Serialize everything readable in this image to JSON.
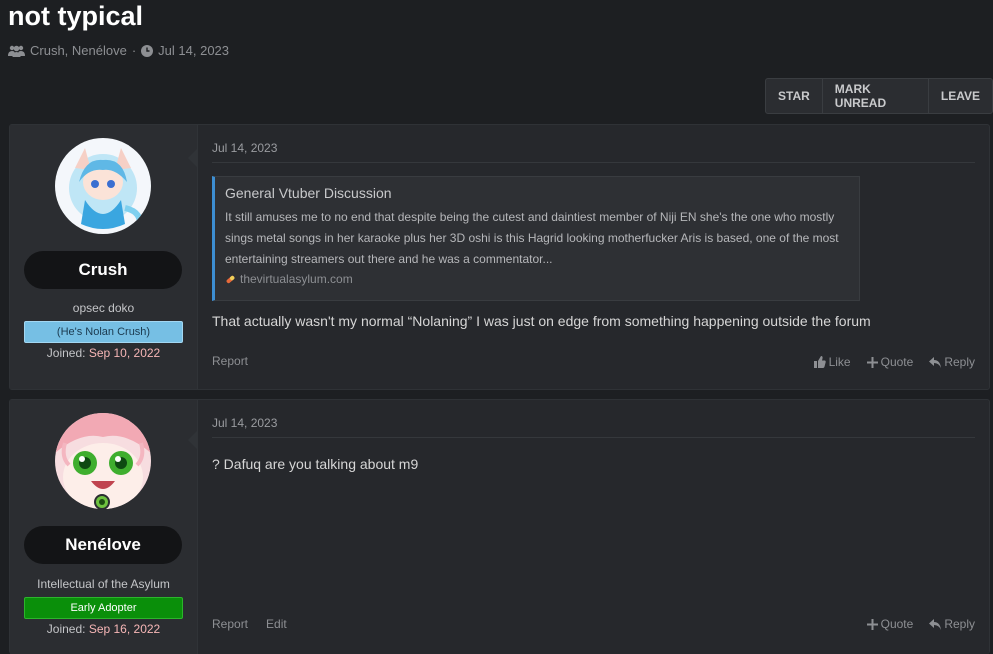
{
  "thread": {
    "title": "not typical",
    "participants": "Crush, Nenélove",
    "separator": "·",
    "date": "Jul 14, 2023"
  },
  "toolbar": {
    "star": "STAR",
    "mark_unread": "MARK UNREAD",
    "leave": "LEAVE"
  },
  "posts": [
    {
      "user": {
        "name": "Crush",
        "title": "opsec doko",
        "banner": "(He's Nolan Crush)",
        "joined_label": "Joined:",
        "joined_date": "Sep 10, 2022"
      },
      "date": "Jul 14, 2023",
      "quote": {
        "title": "General Vtuber Discussion",
        "body": "It still amuses me to no end that despite being the cutest and daintiest member of Niji EN she's the one who mostly sings metal songs in her karaoke plus her 3D oshi is this Hagrid looking motherfucker Aris is based, one of the most entertaining streamers out there and he was a commentator...",
        "source": "thevirtualasylum.com"
      },
      "text": "That actually wasn't my normal “Nolaning” I was just on edge from something happening outside the forum",
      "actions_left": [
        "Report"
      ],
      "actions_right": {
        "like": "Like",
        "quote": "Quote",
        "reply": "Reply"
      }
    },
    {
      "user": {
        "name": "Nenélove",
        "title": "Intellectual of the Asylum",
        "banner": "Early Adopter",
        "joined_label": "Joined:",
        "joined_date": "Sep 16, 2022"
      },
      "date": "Jul 14, 2023",
      "text": "? Dafuq are you talking about m9",
      "actions_left": [
        "Report",
        "Edit"
      ],
      "actions_right": {
        "quote": "Quote",
        "reply": "Reply"
      }
    }
  ],
  "colors": {
    "background": "#1d1f22",
    "post_bg": "#26282c",
    "quote_accent": "#3d8ed2",
    "banner_blue": "#76bfe4",
    "banner_green": "#0a8f0a",
    "joined_date": "#f6b6b6"
  }
}
